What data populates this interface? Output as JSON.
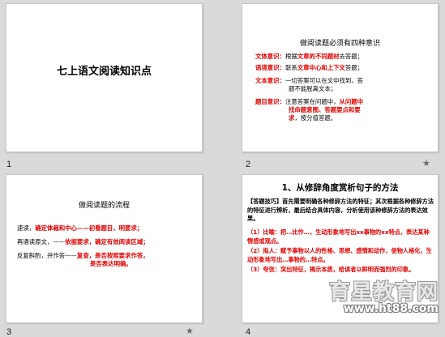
{
  "slides": [
    {
      "number": "1",
      "title": "七上语文阅读知识点"
    },
    {
      "number": "2",
      "title": "做阅读题必须有四种意识",
      "items": [
        {
          "label": "文体意识：",
          "text_lines": [
            "根据文章的不同题材去答题；"
          ],
          "emph": [
            "文章的不同题材"
          ]
        },
        {
          "label": "语境意识：",
          "text_lines": [
            "联系文章中心和上下文答题；"
          ],
          "emph": [
            "文章中心和上下文"
          ]
        },
        {
          "label": "文本意识：",
          "text_lines": [
            "一切答案可以在文中找到，答",
            "题不能脱离文本；"
          ],
          "emph": []
        },
        {
          "label": "题目意识：",
          "text_lines": [
            "注意答案在问题中，从问题中",
            "找命题意图、答题要点和要",
            "求，按分值答题。"
          ],
          "emph": [
            "从问题中",
            "找命题意图、答题要点和要",
            "求"
          ]
        }
      ]
    },
    {
      "number": "3",
      "title": "做阅读题的流程",
      "lines": [
        {
          "prefix": "速读，",
          "red": "确定体裁和中心——初看题目，明要求；"
        },
        {
          "prefix": "再通读原文，——",
          "red": "依据要求，确定有效阅读区域；"
        },
        {
          "prefix": "反复斟酌，并作答——",
          "red": "复查，是否按照要求作答，",
          "red2": "是否表达明确。"
        }
      ]
    },
    {
      "number": "4",
      "title": "1、从修辞角度赏析句子的方法",
      "intro": "【答题技巧】首先需要明确各种修辞方法的特征；其次根据各种修辞方法的特征进行辨析，最后结合具体内容，分析使用该种修辞方法的表达效果。",
      "points": [
        "（1）比喻：把…比作…，生动形象地写出xx事物的xx特点，表达某种情感或观点。",
        "（2）拟人：赋予事物以人的性格、思想、感情和动作，使物人格化，生动形象地写出…事物的…特点。",
        "（3）夸张：突出特征，揭示本质，给读者以鲜明而强烈的印象。"
      ]
    }
  ],
  "watermark": {
    "main": "育星教育网",
    "url": "www.ht88.com"
  },
  "icons": {
    "slide_transition": "star-icon"
  }
}
